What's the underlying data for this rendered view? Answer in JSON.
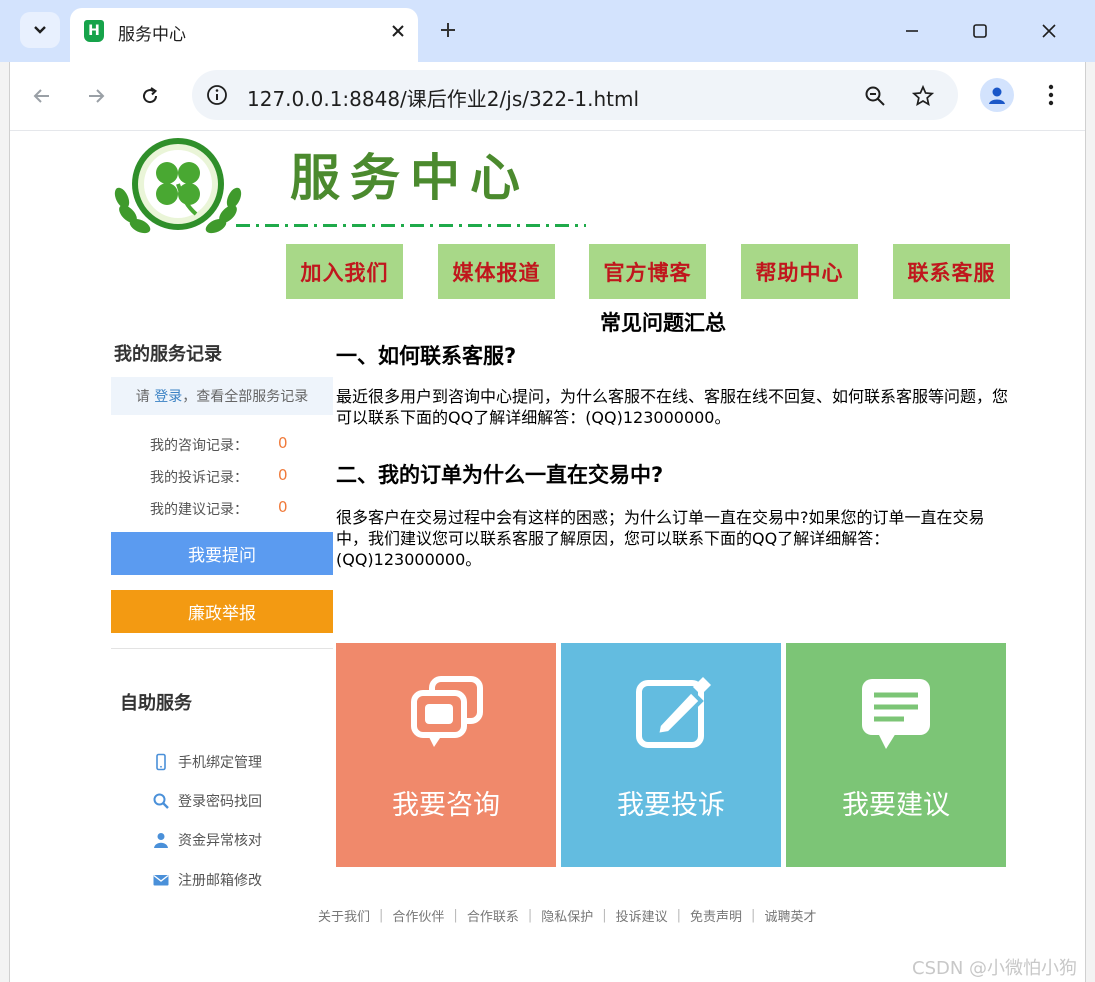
{
  "browser": {
    "tab_title": "服务中心",
    "tab_favicon": "H",
    "url": "127.0.0.1:8848/课后作业2/js/322-1.html"
  },
  "header": {
    "brand_title": "服务中心",
    "nav": [
      "加入我们",
      "媒体报道",
      "官方博客",
      "帮助中心",
      "联系客服"
    ]
  },
  "faq": {
    "title": "常见问题汇总",
    "questions": [
      {
        "heading": "一、如何联系客服?",
        "text": "最近很多用户到咨询中心提问，为什么客服不在线、客服在线不回复、如何联系客服等问题，您可以联系下面的QQ了解详细解答：(QQ)123000000。"
      },
      {
        "heading": "二、我的订单为什么一直在交易中?",
        "text": "很多客户在交易过程中会有这样的困惑；为什么订单一直在交易中?如果您的订单一直在交易中，我们建议您可以联系客服了解原因，您可以联系下面的QQ了解详细解答：(QQ)123000000。"
      }
    ]
  },
  "sidebar": {
    "records_heading": "我的服务记录",
    "login_prefix": "请 ",
    "login_link": "登录",
    "login_suffix": "，查看全部服务记录",
    "records": [
      {
        "label": "我的咨询记录：",
        "count": "0"
      },
      {
        "label": "我的投诉记录：",
        "count": "0"
      },
      {
        "label": "我的建议记录：",
        "count": "0"
      }
    ],
    "ask_button": "我要提问",
    "report_button": "廉政举报",
    "self_service_heading": "自助服务",
    "self_service_items": [
      {
        "label": "手机绑定管理",
        "icon": "phone-icon"
      },
      {
        "label": "登录密码找回",
        "icon": "search-icon"
      },
      {
        "label": "资金异常核对",
        "icon": "user-icon"
      },
      {
        "label": "注册邮箱修改",
        "icon": "mail-icon"
      }
    ]
  },
  "cards": [
    {
      "label": "我要咨询",
      "icon": "chat-bubbles-icon",
      "color": "#f0896b"
    },
    {
      "label": "我要投诉",
      "icon": "edit-icon",
      "color": "#63bce0"
    },
    {
      "label": "我要建议",
      "icon": "message-icon",
      "color": "#7cc576"
    }
  ],
  "footer": {
    "links": [
      "关于我们",
      "合作伙伴",
      "合作联系",
      "隐私保护",
      "投诉建议",
      "免责声明",
      "诚聘英才"
    ]
  },
  "watermark": "CSDN @小微怕小狗",
  "colors": {
    "nav_bg": "#a8d888",
    "nav_text": "#c0171d",
    "brand_green": "#4b8a2e",
    "ask_button": "#5b9bf0",
    "report_button": "#f39a12",
    "record_count": "#f07a3a"
  }
}
